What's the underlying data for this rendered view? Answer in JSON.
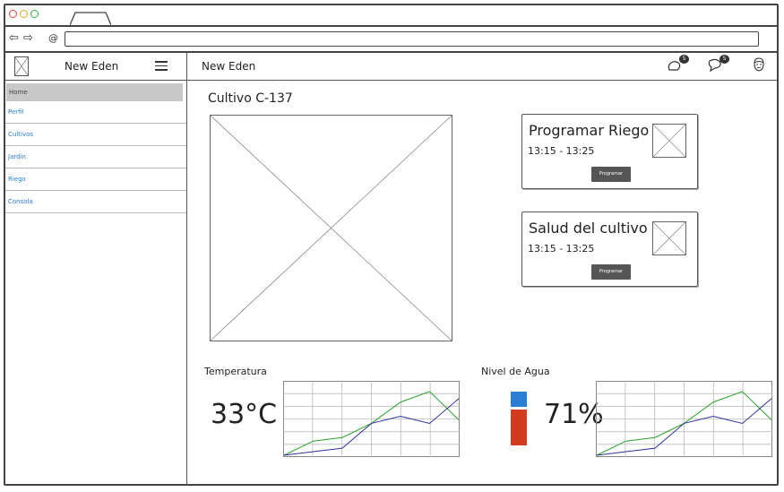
{
  "browser": {
    "address": ""
  },
  "sidebar": {
    "title": "New Eden",
    "items": [
      {
        "label": "Home"
      },
      {
        "label": "Perfil"
      },
      {
        "label": "Cultivos"
      },
      {
        "label": "Jardín"
      },
      {
        "label": "Riego"
      },
      {
        "label": "Consola"
      }
    ]
  },
  "header": {
    "title": "New Eden",
    "icons": [
      "notifications-icon",
      "messages-icon",
      "user-avatar-icon"
    ],
    "notifications_count": "5",
    "messages_count": "5"
  },
  "main": {
    "crop_title": "Cultivo C-137",
    "cards": [
      {
        "title": "Programar Riego",
        "time": "13:15 - 13:25",
        "button": "Programar"
      },
      {
        "title": "Salud del cultivo",
        "time": "13:15 - 13:25",
        "button": "Programar"
      }
    ],
    "temperature": {
      "label": "Temperatura",
      "value": "33°C"
    },
    "water": {
      "label": "Nivel de Agua",
      "value": "71%",
      "level": 0.71,
      "top_color": "#2a7fd4",
      "bottom_color": "#d23c1e"
    }
  },
  "chart_data": [
    {
      "type": "line",
      "x": [
        0,
        1,
        2,
        3,
        4,
        5,
        6
      ],
      "series": [
        {
          "color": "#2aa02a",
          "values": [
            0,
            20,
            25,
            45,
            75,
            90,
            50
          ]
        },
        {
          "color": "#3030a0",
          "values": [
            0,
            5,
            10,
            45,
            55,
            45,
            80
          ]
        }
      ],
      "ylim": [
        0,
        100
      ],
      "grid": true
    },
    {
      "type": "line",
      "x": [
        0,
        1,
        2,
        3,
        4,
        5,
        6
      ],
      "series": [
        {
          "color": "#2aa02a",
          "values": [
            0,
            20,
            25,
            45,
            75,
            90,
            50
          ]
        },
        {
          "color": "#3030a0",
          "values": [
            0,
            5,
            10,
            45,
            55,
            45,
            80
          ]
        }
      ],
      "ylim": [
        0,
        100
      ],
      "grid": true
    }
  ]
}
